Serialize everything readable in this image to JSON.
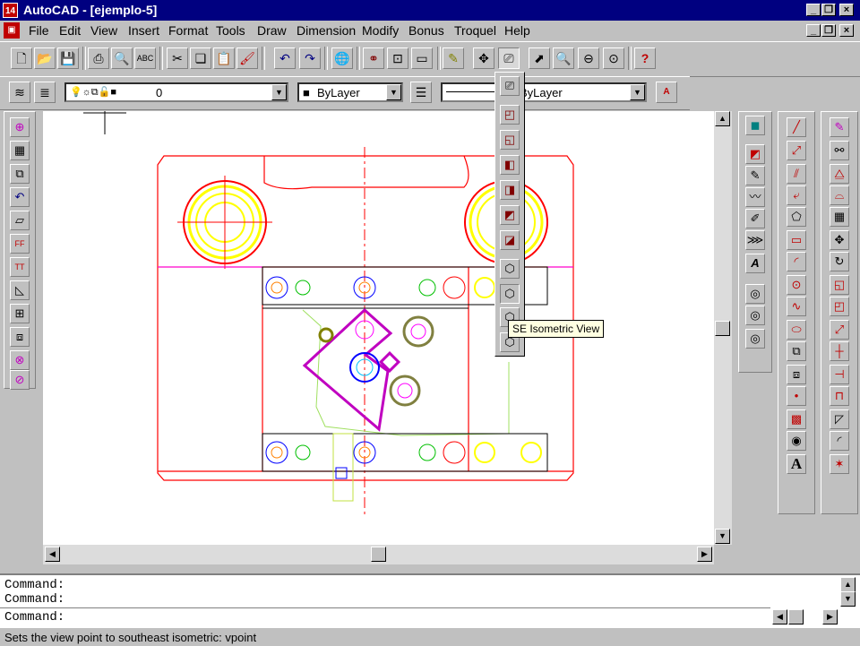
{
  "window": {
    "title": "AutoCAD - [ejemplo-5]",
    "app_icon_label": "14"
  },
  "menu": {
    "items": [
      {
        "label": "File"
      },
      {
        "label": "Edit"
      },
      {
        "label": "View"
      },
      {
        "label": "Insert"
      },
      {
        "label": "Format"
      },
      {
        "label": "Tools"
      },
      {
        "label": "Draw"
      },
      {
        "label": "Dimension"
      },
      {
        "label": "Modify"
      },
      {
        "label": "Bonus"
      },
      {
        "label": "Troquel"
      },
      {
        "label": "Help"
      }
    ]
  },
  "standard_toolbar": {
    "icons": [
      "new-icon",
      "open-icon",
      "save-icon",
      "print-icon",
      "print-preview-icon",
      "spelling-icon",
      "cut-icon",
      "copy-icon",
      "paste-icon",
      "match-properties-icon",
      "undo-icon",
      "redo-icon",
      "browse-web-icon",
      "snap-icon",
      "object-group-icon",
      "inquiry-icon",
      "redraw-icon",
      "pan-icon",
      "named-views-icon",
      "zoom-realtime-icon",
      "zoom-window-icon",
      "zoom-previous-icon",
      "help-icon"
    ],
    "help_glyph": "?"
  },
  "properties_toolbar": {
    "layer_value": "0",
    "color_value": "ByLayer",
    "linetype_value": "ByLayer"
  },
  "view_flyout": {
    "items": [
      "named-views-icon",
      "top-view-icon",
      "bottom-view-icon",
      "left-view-icon",
      "right-view-icon",
      "front-view-icon",
      "back-view-icon",
      "sw-isometric-icon",
      "se-isometric-icon",
      "ne-isometric-icon",
      "nw-isometric-icon"
    ],
    "tooltip": "SE Isometric View"
  },
  "draw_toolbar": {
    "text_glyph": "A"
  },
  "command": {
    "lines": [
      "Command:",
      "Command:"
    ],
    "prompt": "Command:"
  },
  "status": {
    "text": "Sets the view point to southeast isometric:  vpoint"
  },
  "colors": {
    "titlebar": "#000080",
    "red": "#ff0000",
    "magenta": "#ff00ff",
    "yellow": "#ffff00"
  }
}
